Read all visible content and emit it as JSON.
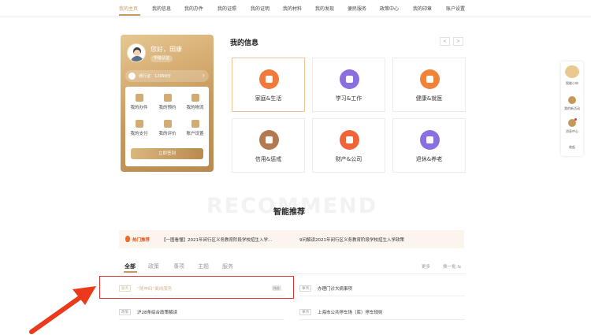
{
  "nav": {
    "items": [
      "我的主页",
      "我的信息",
      "我的办件",
      "我的证照",
      "我的证明",
      "我的材料",
      "我的发现",
      "便民服务",
      "政策中心",
      "我的印章",
      "账户设置"
    ]
  },
  "profile": {
    "greeting": "您好，田康",
    "cert_label": "中级认证",
    "points_text": "通行证　12999分",
    "quick_items": [
      "我的办件",
      "我的预约",
      "我的物流",
      "我的支付",
      "我的评价",
      "账户设置"
    ],
    "checkin_label": "立即签到"
  },
  "info": {
    "title": "我的信息",
    "prev": "<",
    "next": ">",
    "cards": [
      {
        "label": "家庭&生活",
        "color": "#f2793c"
      },
      {
        "label": "学习&工作",
        "color": "#8a6fe0"
      },
      {
        "label": "健康&就医",
        "color": "#f0823a"
      },
      {
        "label": "信用&惩戒",
        "color": "#b37a52"
      },
      {
        "label": "财产&公司",
        "color": "#f0643a"
      },
      {
        "label": "退休&养老",
        "color": "#8a6fe0"
      }
    ]
  },
  "side": {
    "items": [
      "智能小申",
      "我的新活动",
      "消息中心",
      "收起"
    ]
  },
  "recommend": {
    "watermark": "RECOMMEND",
    "title": "智能推荐",
    "hot_label": "热门推荐",
    "hot_items": [
      "【一图看懂】2021年闵行区义务教育阶段学校招生入学…",
      "9问解读2021年闵行区义务教育阶段学校招生入学政策"
    ],
    "tabs": [
      "全部",
      "政策",
      "事项",
      "主题",
      "服务"
    ],
    "more": "更多",
    "refresh": "换一批 ⇆",
    "rows": [
      {
        "tag": "服务",
        "text": "“随申码”离线服务",
        "badge": "待办"
      },
      {
        "tag": "事项",
        "text": "办理门诊大病事项"
      },
      {
        "tag": "政策",
        "text": "沪28条综合政策解读"
      },
      {
        "tag": "事项",
        "text": "上海市公共停车场（库）停车规则"
      }
    ]
  }
}
